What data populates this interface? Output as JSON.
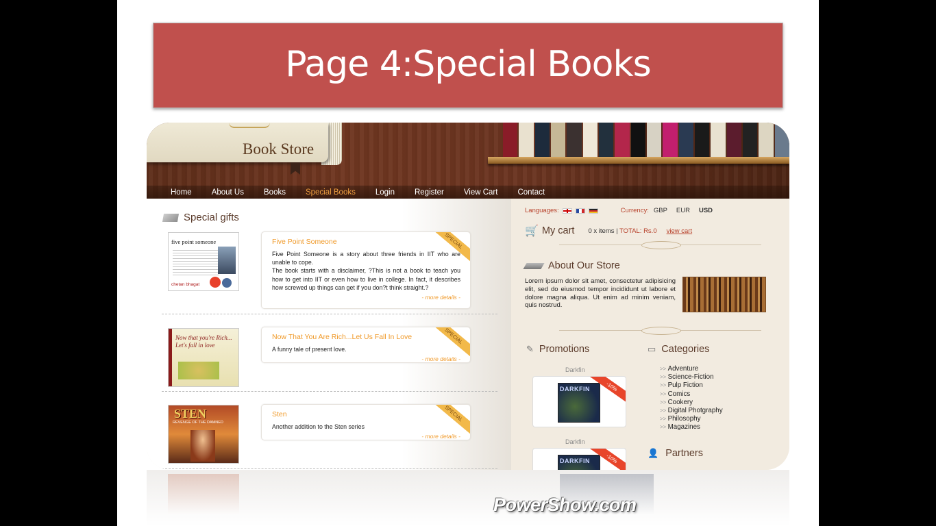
{
  "slide": {
    "title": "Page 4:Special Books",
    "watermark": "PowerShow.com"
  },
  "site": {
    "logo_text": "Book Store",
    "nav": [
      "Home",
      "About Us",
      "Books",
      "Special Books",
      "Login",
      "Register",
      "View Cart",
      "Contact"
    ],
    "nav_active": "Special Books",
    "left": {
      "section_title": "Special gifts",
      "gifts": [
        {
          "title": "Five Point Someone",
          "ribbon": "SPECIAL",
          "description": "Five Point Someone is a story about three friends in IIT who are unable to cope.",
          "description2": "The book starts with a disclaimer, ?This is not a book to teach you how to get into IIT or even how to live in college. In fact, it describes how screwed up things can get if you don?t think straight.?",
          "more": "- more details -",
          "cover_text": "five point someone",
          "cover_author": "chetan bhagat"
        },
        {
          "title": "Now That You Are Rich...Let Us Fall In Love",
          "ribbon": "SPECIAL",
          "description": "A funny tale of present love.",
          "more": "- more details -",
          "cover_text": "Now that you're Rich... Let's fall in love"
        },
        {
          "title": "Sten",
          "ribbon": "SPECIAL",
          "description": "Another addition to the Sten series",
          "more": "- more details -",
          "cover_text": "STEN",
          "cover_sub": "REVENGE OF THE DAMNED"
        }
      ]
    },
    "right": {
      "languages_label": "Languages:",
      "currency_label": "Currency:",
      "currencies": [
        "GBP",
        "EUR",
        "USD"
      ],
      "selected_currency": "USD",
      "cart_title": "My cart",
      "cart_items": "0 x items | ",
      "cart_total": "TOTAL: Rs.0",
      "view_cart": "view cart",
      "about_title": "About Our Store",
      "about_text": "Lorem ipsum dolor sit amet, consectetur adipisicing elit, sed do eiusmod tempor incididunt ut labore et dolore magna aliqua. Ut enim ad minim veniam, quis nostrud.",
      "promotions_title": "Promotions",
      "promotions": [
        {
          "label": "Darkfin",
          "badge": "-10%",
          "cover": "DARKFIN"
        },
        {
          "label": "Darkfin",
          "badge": "-10%",
          "cover": "DARKFIN"
        }
      ],
      "categories_title": "Categories",
      "categories": [
        "Adventure",
        "Science-Fiction",
        "Pulp Fiction",
        "Comics",
        "Cookery",
        "Digital Photgraphy",
        "Philosophy",
        "Magazines"
      ],
      "partners_title": "Partners"
    }
  },
  "colors": {
    "title_bar": "#c0504d",
    "accent_orange": "#f09a2a",
    "link_red": "#b7402a"
  }
}
